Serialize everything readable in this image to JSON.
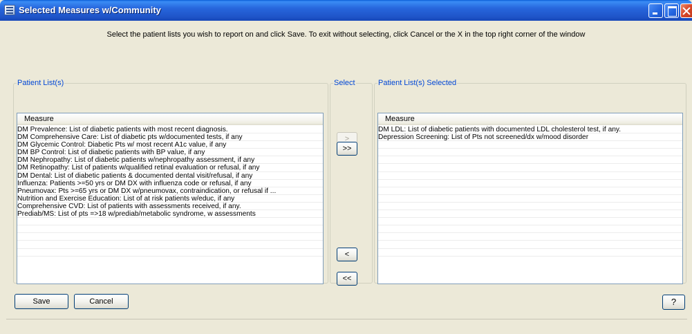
{
  "window": {
    "title": "Selected Measures w/Community",
    "icon": "app-list-icon"
  },
  "instructions": "Select the patient lists you wish to report on and click Save.  To exit without selecting, click Cancel or the X in the top right corner of the window",
  "left_group": {
    "title": "Patient List(s)",
    "column_header": "Measure",
    "items": [
      "DM Prevalence: List of diabetic patients with most recent diagnosis.",
      "DM Comprehensive Care: List of diabetic pts w/documented tests, if any",
      "DM Glycemic Control: Diabetic Pts w/ most recent A1c value, if any",
      "DM BP Control: List of diabetic patients with BP value, if any",
      "DM Nephropathy: List of diabetic patients w/nephropathy assessment, if any",
      "DM Retinopathy: List of patients w/qualified retinal evaluation or refusal, if any",
      "DM Dental: List of diabetic patients & documented dental visit/refusal, if any",
      "Influenza: Patients >=50 yrs or DM DX with influenza code or refusal, if any",
      "Pneumovax: Pts >=65 yrs or DM DX w/pneumovax, contraindication, or refusal if ...",
      "Nutrition and Exercise Education: List of at risk patients w/educ, if any",
      "Comprehensive CVD: List of patients with assessments received, if any.",
      "Prediab/MS: List of pts =>18 w/prediab/metabolic syndrome, w assessments"
    ],
    "empty_rows": 5
  },
  "select_group": {
    "title": "Select",
    "add_label": ">",
    "add_all_label": ">>",
    "remove_label": "<",
    "remove_all_label": "<<"
  },
  "right_group": {
    "title": "Patient List(s) Selected",
    "column_header": "Measure",
    "items": [
      "DM LDL: List of diabetic patients with documented LDL cholesterol test, if any.",
      "Depression Screening: List of Pts not screened/dx w/mood disorder"
    ],
    "empty_rows": 15
  },
  "buttons": {
    "save": "Save",
    "cancel": "Cancel",
    "help": "?"
  }
}
